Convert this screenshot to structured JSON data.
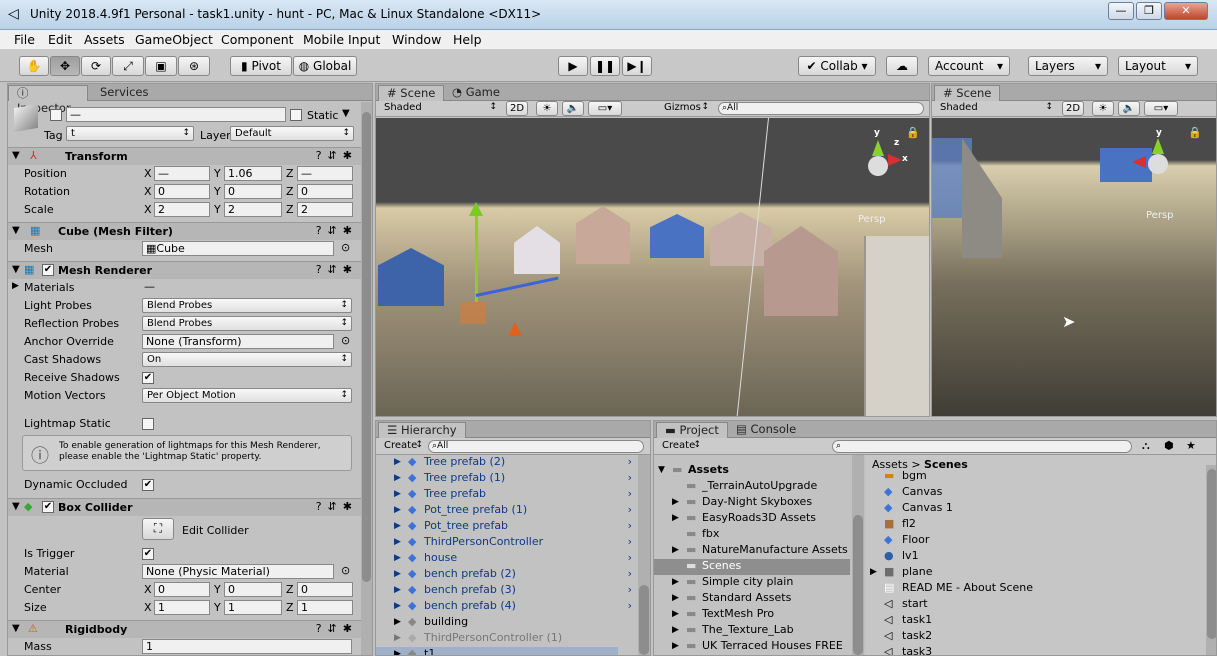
{
  "window": {
    "title": "Unity 2018.4.9f1 Personal - task1.unity - hunt - PC, Mac & Linux Standalone <DX11>",
    "min": "—",
    "max": "❐",
    "close": "✕"
  },
  "menu": [
    "File",
    "Edit",
    "Assets",
    "GameObject",
    "Component",
    "Mobile Input",
    "Window",
    "Help"
  ],
  "toolbar": {
    "pivot": "Pivot",
    "global": "Global",
    "collab": "Collab ▾",
    "account": "Account",
    "layers": "Layers",
    "layout": "Layout"
  },
  "inspector": {
    "tabs": [
      "Inspector",
      "Services"
    ],
    "name_value": "—",
    "static_label": "Static",
    "tag_label": "Tag",
    "tag_value": "t",
    "layer_label": "Layer",
    "layer_value": "Default",
    "transform": {
      "title": "Transform",
      "position_label": "Position",
      "rotation_label": "Rotation",
      "scale_label": "Scale",
      "pos": [
        "—",
        "1.06",
        "—"
      ],
      "rot": [
        "0",
        "0",
        "0"
      ],
      "scale": [
        "2",
        "2",
        "2"
      ]
    },
    "mesh_filter": {
      "title": "Cube (Mesh Filter)",
      "mesh_label": "Mesh",
      "mesh_value": "Cube"
    },
    "mesh_renderer": {
      "title": "Mesh Renderer",
      "materials": "Materials",
      "light_probes": "Light Probes",
      "light_probes_val": "Blend Probes",
      "reflection_probes": "Reflection Probes",
      "reflection_probes_val": "Blend Probes",
      "anchor": "Anchor Override",
      "anchor_val": "None (Transform)",
      "cast": "Cast Shadows",
      "cast_val": "On",
      "receive": "Receive Shadows",
      "motion": "Motion Vectors",
      "motion_val": "Per Object Motion",
      "lightmap": "Lightmap Static",
      "info": "To enable generation of lightmaps for this Mesh Renderer, please enable the 'Lightmap Static' property.",
      "dynamic": "Dynamic Occluded"
    },
    "box_collider": {
      "title": "Box Collider",
      "edit": "Edit Collider",
      "trigger": "Is Trigger",
      "material": "Material",
      "material_val": "None (Physic Material)",
      "center": "Center",
      "center_val": [
        "0",
        "0",
        "0"
      ],
      "size": "Size",
      "size_val": [
        "1",
        "1",
        "1"
      ]
    },
    "rigidbody": {
      "title": "Rigidbody",
      "mass": "Mass",
      "mass_val": "1"
    }
  },
  "scene": {
    "tabs": [
      "Scene",
      "Game"
    ],
    "shaded": "Shaded",
    "mode2d": "2D",
    "gizmos": "Gizmos",
    "search": "All",
    "persp": "Persp"
  },
  "scene2": {
    "tab": "Scene",
    "shaded": "Shaded",
    "mode2d": "2D",
    "persp": "Persp"
  },
  "hierarchy": {
    "tab": "Hierarchy",
    "create": "Create",
    "search": "All",
    "items": [
      "Tree prefab (2)",
      "Tree prefab (1)",
      "Tree prefab",
      "Pot_tree prefab (1)",
      "Pot_tree prefab",
      "ThirdPersonController",
      "house",
      "bench prefab (2)",
      "bench prefab (3)",
      "bench prefab (4)",
      "building",
      "ThirdPersonController (1)",
      "t1"
    ]
  },
  "project": {
    "tabs": [
      "Project",
      "Console"
    ],
    "create": "Create",
    "tree": [
      "Assets",
      "_TerrainAutoUpgrade",
      "Day-Night Skyboxes",
      "EasyRoads3D Assets",
      "fbx",
      "NatureManufacture Assets",
      "Scenes",
      "Simple city plain",
      "Standard Assets",
      "TextMesh Pro",
      "The_Texture_Lab",
      "UK Terraced Houses FREE"
    ],
    "breadcrumb": [
      "Assets",
      "Scenes"
    ],
    "files": [
      "bgm",
      "Canvas",
      "Canvas 1",
      "fl2",
      "Floor",
      "lv1",
      "plane",
      "READ ME - About Scene",
      "start",
      "task1",
      "task2",
      "task3"
    ]
  }
}
